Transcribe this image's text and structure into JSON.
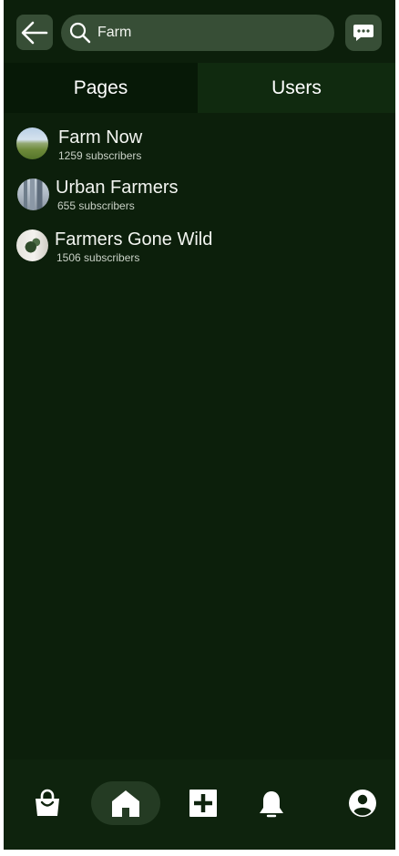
{
  "search": {
    "value": "Farm",
    "placeholder": ""
  },
  "tabs": [
    {
      "label": "Pages",
      "active": true
    },
    {
      "label": "Users",
      "active": false
    }
  ],
  "results": [
    {
      "name": "Farm Now",
      "subscribers": "1259 subscribers",
      "avatar": "farm-field-photo"
    },
    {
      "name": "Urban Farmers",
      "subscribers": "655 subscribers",
      "avatar": "city-skyline-photo"
    },
    {
      "name": "Farmers Gone Wild",
      "subscribers": "1506 subscribers",
      "avatar": "plant-photo"
    }
  ],
  "bottom_nav": [
    {
      "icon": "shopping-bag-icon",
      "active": false
    },
    {
      "icon": "home-icon",
      "active": true
    },
    {
      "icon": "add-icon",
      "active": false
    },
    {
      "icon": "bell-icon",
      "active": false
    },
    {
      "icon": "profile-icon",
      "active": false
    }
  ],
  "colors": {
    "background": "#0c1f0b",
    "surface": "#374e36",
    "tab_active": "#071907",
    "tab_inactive": "#102a0f",
    "text": "#ffffff"
  }
}
